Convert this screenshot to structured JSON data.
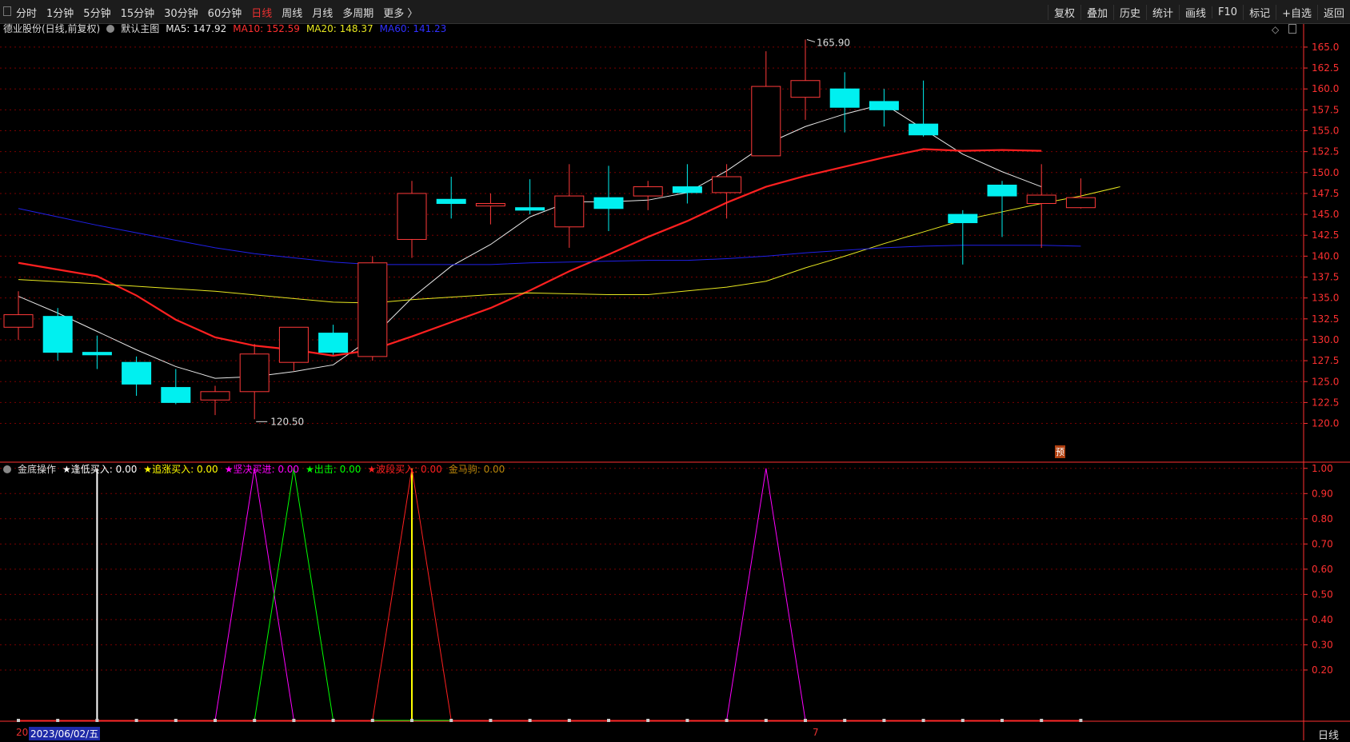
{
  "toolbar": {
    "tabs": [
      "分时",
      "1分钟",
      "5分钟",
      "15分钟",
      "30分钟",
      "60分钟",
      "日线",
      "周线",
      "月线",
      "多周期",
      "更多 〉"
    ],
    "active_tab": "日线",
    "tools": [
      "复权",
      "叠加",
      "历史",
      "统计",
      "画线",
      "F10",
      "+自选",
      "返回"
    ],
    "tools_extra": "标记"
  },
  "main_legend": {
    "title": "德业股份(日线,前复权)",
    "template": "默认主图",
    "ma5": "MA5: 147.92",
    "ma10": "MA10: 152.59",
    "ma20": "MA20: 148.37",
    "ma60": "MA60: 141.23"
  },
  "sub_legend": {
    "title": "金底操作",
    "items": [
      {
        "label": "★逢低买入: 0.00",
        "color": "#ffffff"
      },
      {
        "label": "★追涨买入: 0.00",
        "color": "#ffff00"
      },
      {
        "label": "★坚决买进: 0.00",
        "color": "#ff00ff"
      },
      {
        "label": "★出击: 0.00",
        "color": "#00ff00"
      },
      {
        "label": "★波段买入: 0.00",
        "color": "#ff2020"
      },
      {
        "label": "金马驹: 0.00",
        "color": "#b8860b"
      }
    ]
  },
  "labels": {
    "high": "165.90",
    "low": "120.50",
    "date": "2023/06/02/五",
    "date_pre": "20",
    "date_mid": "7",
    "yu": "预",
    "period": "日线"
  },
  "colors": {
    "up": "#ff3a3a",
    "down": "#00f0f0",
    "ma5": "#e8e8e8",
    "ma10": "#ff2020",
    "ma20": "#e8e820",
    "ma60": "#2020e8",
    "grid": "#7a0000",
    "axis": "#ff3030"
  },
  "chart_data": [
    {
      "type": "candlestick",
      "title": "德业股份(日线,前复权)",
      "ylim": [
        119,
        167
      ],
      "yticks": [
        120.0,
        122.5,
        125.0,
        127.5,
        130.0,
        132.5,
        135.0,
        137.5,
        140.0,
        142.5,
        145.0,
        147.5,
        150.0,
        152.5,
        155.0,
        157.5,
        160.0,
        162.5,
        165.0
      ],
      "candles": [
        {
          "o": 131.5,
          "c": 133.0,
          "h": 135.8,
          "l": 130.0
        },
        {
          "o": 132.8,
          "c": 128.5,
          "h": 133.8,
          "l": 127.5
        },
        {
          "o": 128.5,
          "c": 128.2,
          "h": 130.5,
          "l": 126.5
        },
        {
          "o": 127.3,
          "c": 124.7,
          "h": 128.0,
          "l": 123.3
        },
        {
          "o": 124.3,
          "c": 122.5,
          "h": 126.5,
          "l": 122.3
        },
        {
          "o": 122.8,
          "c": 123.8,
          "h": 124.5,
          "l": 121.0
        },
        {
          "o": 123.8,
          "c": 128.3,
          "h": 129.5,
          "l": 120.5
        },
        {
          "o": 127.3,
          "c": 131.5,
          "h": 131.5,
          "l": 126.3
        },
        {
          "o": 130.8,
          "c": 128.5,
          "h": 131.8,
          "l": 128.2
        },
        {
          "o": 128.0,
          "c": 139.2,
          "h": 140.0,
          "l": 127.5
        },
        {
          "o": 142.0,
          "c": 147.5,
          "h": 149.0,
          "l": 139.8
        },
        {
          "o": 146.8,
          "c": 146.3,
          "h": 149.5,
          "l": 144.5
        },
        {
          "o": 146.0,
          "c": 146.3,
          "h": 147.5,
          "l": 143.8
        },
        {
          "o": 145.8,
          "c": 145.5,
          "h": 149.2,
          "l": 145.0
        },
        {
          "o": 143.5,
          "c": 147.2,
          "h": 151.0,
          "l": 141.0
        },
        {
          "o": 147.0,
          "c": 145.7,
          "h": 150.8,
          "l": 143.0
        },
        {
          "o": 147.2,
          "c": 148.3,
          "h": 149.0,
          "l": 145.5
        },
        {
          "o": 148.3,
          "c": 147.6,
          "h": 151.0,
          "l": 146.3
        },
        {
          "o": 147.6,
          "c": 149.5,
          "h": 151.0,
          "l": 144.5
        },
        {
          "o": 152.0,
          "c": 160.3,
          "h": 164.5,
          "l": 152.0
        },
        {
          "o": 159.0,
          "c": 161.0,
          "h": 165.9,
          "l": 156.3
        },
        {
          "o": 160.0,
          "c": 157.8,
          "h": 162.0,
          "l": 154.8
        },
        {
          "o": 158.5,
          "c": 157.5,
          "h": 160.0,
          "l": 155.5
        },
        {
          "o": 155.8,
          "c": 154.5,
          "h": 161.0,
          "l": 154.3
        },
        {
          "o": 145.0,
          "c": 144.0,
          "h": 145.5,
          "l": 139.0
        },
        {
          "o": 148.5,
          "c": 147.2,
          "h": 149.0,
          "l": 142.3
        },
        {
          "o": 146.3,
          "c": 147.3,
          "h": 151.0,
          "l": 141.0
        },
        {
          "o": 145.8,
          "c": 147.0,
          "h": 149.3,
          "l": 145.7
        }
      ],
      "series": [
        {
          "name": "MA5",
          "values": [
            135.2,
            133.2,
            131.0,
            128.8,
            126.8,
            125.4,
            125.6,
            126.2,
            127.0,
            130.3,
            135.0,
            138.8,
            141.4,
            144.7,
            146.5,
            146.5,
            146.7,
            147.6,
            150.2,
            153.4,
            155.5,
            157.0,
            158.2,
            155.2,
            152.2,
            150.1,
            148.3
          ]
        },
        {
          "name": "MA10",
          "values": [
            139.2,
            138.4,
            137.6,
            135.3,
            132.4,
            130.3,
            129.3,
            128.8,
            128.1,
            128.8,
            130.4,
            132.1,
            133.8,
            135.9,
            138.2,
            140.2,
            142.3,
            144.2,
            146.4,
            148.3,
            149.6,
            150.7,
            151.8,
            152.8,
            152.6,
            152.7,
            152.6
          ]
        },
        {
          "name": "MA20",
          "values": [
            137.2,
            null,
            136.7,
            null,
            null,
            135.8,
            null,
            null,
            134.5,
            134.4,
            134.8,
            null,
            135.4,
            135.6,
            null,
            135.4,
            135.4,
            null,
            136.3,
            137.0,
            138.6,
            140.0,
            141.5,
            142.9,
            144.3,
            145.3,
            146.3,
            147.2,
            148.3
          ]
        },
        {
          "name": "MA60",
          "values": [
            145.7,
            144.7,
            143.7,
            142.8,
            141.9,
            141.0,
            140.3,
            139.8,
            139.3,
            139.0,
            139.0,
            139.0,
            139.0,
            139.2,
            139.3,
            139.4,
            139.5,
            139.5,
            139.7,
            140.0,
            140.4,
            140.7,
            141.0,
            141.2,
            141.3,
            141.3,
            141.3,
            141.2
          ]
        }
      ]
    },
    {
      "type": "line",
      "title": "金底操作",
      "ylim": [
        0,
        1.05
      ],
      "yticks": [
        0.2,
        0.3,
        0.4,
        0.5,
        0.6,
        0.7,
        0.8,
        0.9,
        1.0
      ],
      "series": [
        {
          "name": "★逢低买入",
          "bars": [
            2
          ]
        },
        {
          "name": "★追涨买入",
          "bars": [
            10
          ]
        },
        {
          "name": "★坚决买进",
          "values": [
            0,
            0,
            0,
            0,
            0,
            0,
            1,
            0,
            0,
            0,
            0,
            0,
            0,
            0,
            0,
            0,
            0,
            0,
            0,
            1,
            0,
            0,
            0,
            0,
            0,
            0,
            0,
            0
          ]
        },
        {
          "name": "★出击",
          "values": [
            0,
            0,
            0,
            0,
            0,
            0,
            0,
            1,
            0,
            0,
            0,
            0,
            0,
            0,
            0,
            0,
            0,
            0,
            0,
            0,
            0,
            0,
            0,
            0,
            0,
            0,
            0,
            0
          ]
        },
        {
          "name": "★波段买入",
          "values": [
            0,
            0,
            0,
            0,
            0,
            0,
            0,
            0,
            0,
            0,
            1,
            0,
            0,
            0,
            0,
            0,
            0,
            0,
            0,
            0,
            0,
            0,
            0,
            0,
            0,
            0,
            0,
            0
          ]
        },
        {
          "name": "金马驹",
          "values": []
        }
      ]
    }
  ]
}
